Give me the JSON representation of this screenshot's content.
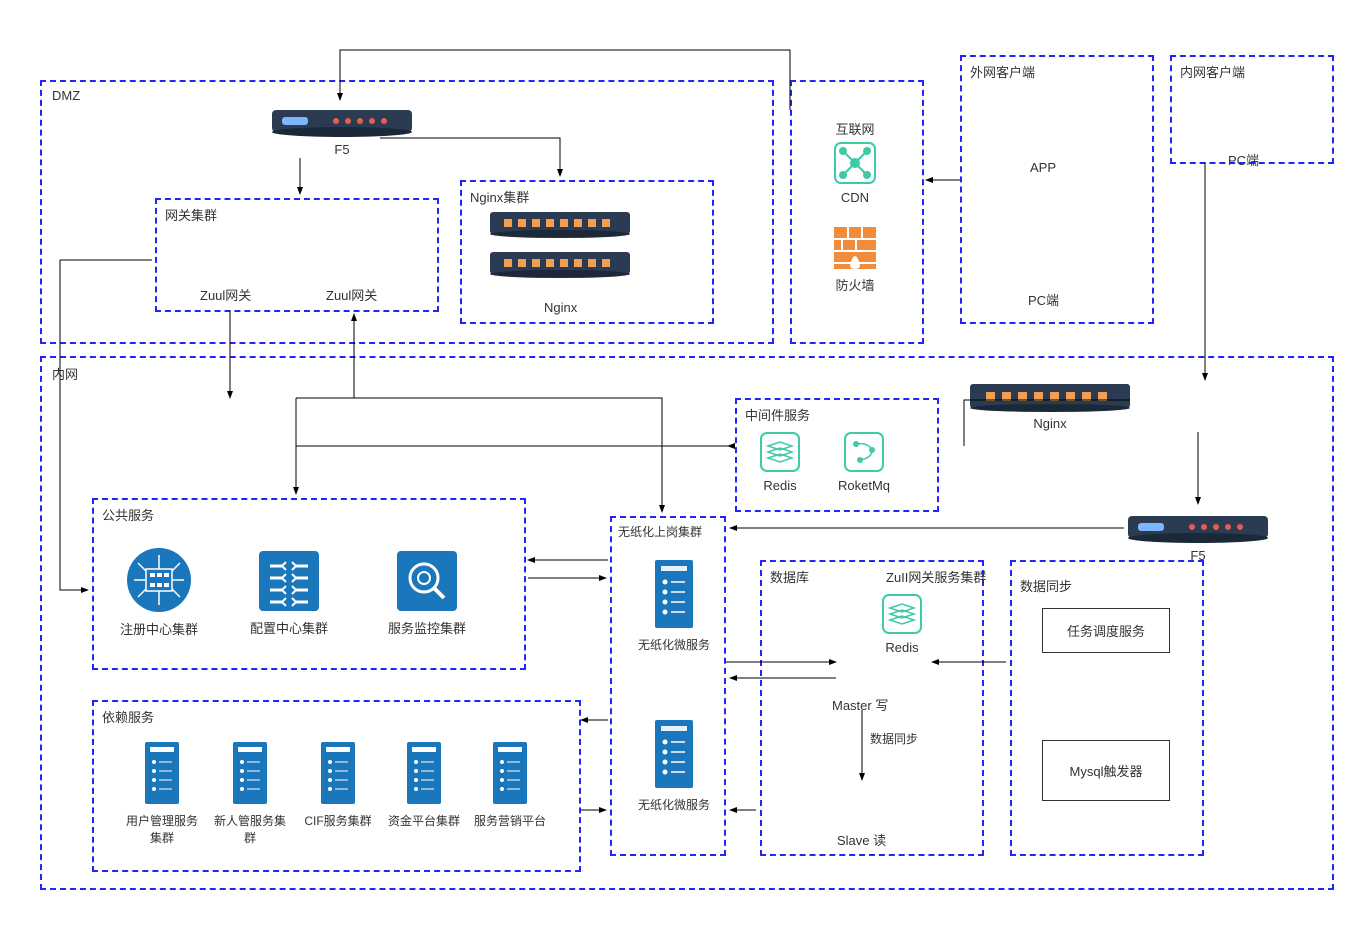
{
  "dmz": {
    "label": "DMZ"
  },
  "intranet": {
    "label": "内网"
  },
  "f5_top": {
    "label": "F5"
  },
  "gateway_cluster": {
    "label": "网关集群",
    "zuul1": "Zuul网关",
    "zuul2": "Zuul网关"
  },
  "nginx_cluster": {
    "label": "Nginx集群",
    "nginx": "Nginx"
  },
  "internet": {
    "title": "互联网",
    "cdn": "CDN",
    "firewall": "防火墙"
  },
  "external_client": {
    "label": "外网客户端",
    "app": "APP",
    "pc": "PC端"
  },
  "internal_client": {
    "label": "内网客户端",
    "pc": "PC端"
  },
  "middleware": {
    "label": "中间件服务",
    "redis": "Redis",
    "rocketmq": "RoketMq"
  },
  "nginx_intranet": "Nginx",
  "public_service": {
    "label": "公共服务",
    "registry": "注册中心集群",
    "config": "配置中心集群",
    "monitor": "服务监控集群"
  },
  "paperless": {
    "label": "无纸化上岗集群",
    "svc1": "无纸化微服务",
    "svc2": "无纸化微服务"
  },
  "dependent": {
    "label": "依赖服务",
    "user": "用户管理服务集群",
    "newuser": "新人管服务集群",
    "cif": "CIF服务集群",
    "fund": "资金平台集群",
    "marketing": "服务营销平台"
  },
  "database": {
    "label": "数据库",
    "redis": "Redis",
    "master": "Master 写",
    "sync": "数据同步",
    "slave": "Slave 读"
  },
  "zuul_gateway": {
    "label": "ZuII网关服务集群",
    "sync_label": "数据同步",
    "scheduler": "任务调度服务",
    "mysql": "Mysql触发器"
  },
  "f5_bottom": {
    "label": "F5"
  }
}
